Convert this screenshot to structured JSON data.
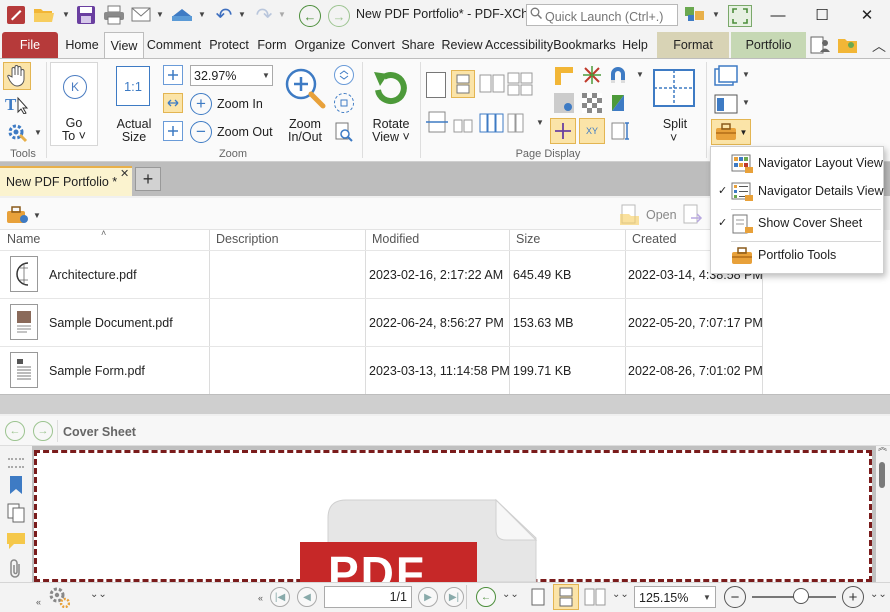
{
  "app": {
    "title": "New PDF Portfolio* - PDF-XCh..."
  },
  "search": {
    "placeholder": "Quick Launch (Ctrl+.)"
  },
  "tabs": [
    {
      "label": "File"
    },
    {
      "label": "Home"
    },
    {
      "label": "View"
    },
    {
      "label": "Comment"
    },
    {
      "label": "Protect"
    },
    {
      "label": "Form"
    },
    {
      "label": "Organize"
    },
    {
      "label": "Convert"
    },
    {
      "label": "Share"
    },
    {
      "label": "Review"
    },
    {
      "label": "Accessibility"
    },
    {
      "label": "Bookmarks"
    },
    {
      "label": "Help"
    },
    {
      "label": "Format"
    },
    {
      "label": "Portfolio"
    }
  ],
  "ribbon": {
    "tools_label": "Tools",
    "goto_label1": "Go",
    "goto_label2": "To",
    "actual_size1": "Actual",
    "actual_size2": "Size",
    "zoom_value": "32.97%",
    "zoom_in": "Zoom In",
    "zoom_out": "Zoom Out",
    "zoom_inout1": "Zoom",
    "zoom_inout2": "In/Out",
    "zoom_group": "Zoom",
    "rotate1": "Rotate",
    "rotate2": "View",
    "page_display_group": "Page Display",
    "split": "Split",
    "actual_icon_text": "1:1",
    "xy_text": "XY"
  },
  "document_tab": {
    "label": "New PDF Portfolio *"
  },
  "portfolio_toolbar": {
    "open_label": "Open"
  },
  "files": {
    "columns": [
      "Name",
      "Description",
      "Modified",
      "Size",
      "Created"
    ],
    "rows": [
      {
        "name": "Architecture.pdf",
        "description": "",
        "modified": "2023-02-16, 2:17:22 AM",
        "size": "645.49 KB",
        "created": "2022-03-14, 4:38:58 PM"
      },
      {
        "name": "Sample Document.pdf",
        "description": "",
        "modified": "2022-06-24, 8:56:27 PM",
        "size": "153.63 MB",
        "created": "2022-05-20, 7:07:17 PM"
      },
      {
        "name": "Sample Form.pdf",
        "description": "",
        "modified": "2023-03-13, 11:14:58 PM",
        "size": "199.71 KB",
        "created": "2022-08-26, 7:01:02 PM"
      }
    ]
  },
  "menu": {
    "items": [
      {
        "label": "Navigator Layout View",
        "checked": false
      },
      {
        "label": "Navigator Details View",
        "checked": true
      },
      {
        "label": "Show Cover Sheet",
        "checked": true
      },
      {
        "label": "Portfolio Tools",
        "checked": false
      }
    ],
    "check_mark": "✓"
  },
  "cover": {
    "label": "Cover Sheet",
    "pdf_text": "PDF"
  },
  "status": {
    "page_value": "1/1",
    "zoom_value": "125.15%"
  },
  "colors": {
    "file_tab": "#b63a3a",
    "accent_orange": "#e8b04a",
    "cover_border": "#7a1c1c",
    "pdf_red": "#c62828"
  }
}
